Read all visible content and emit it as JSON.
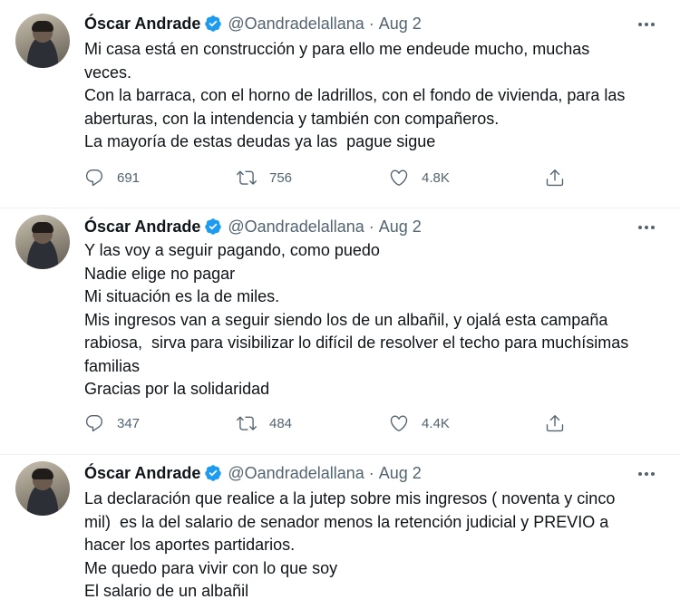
{
  "tweets": [
    {
      "author": "Óscar Andrade",
      "handle": "@Oandradelallana",
      "separator": "·",
      "date": "Aug 2",
      "lines": [
        "Mi casa está en construcción y para ello me endeude mucho, muchas",
        "veces.",
        "Con la barraca, con el horno de ladrillos, con el fondo de vivienda, para las",
        "aberturas, con la intendencia y también con compañeros.",
        "La mayoría de estas deudas ya las  pague sigue"
      ],
      "replies": "691",
      "retweets": "756",
      "likes": "4.8K"
    },
    {
      "author": "Óscar Andrade",
      "handle": "@Oandradelallana",
      "separator": "·",
      "date": "Aug 2",
      "lines": [
        "Y las voy a seguir pagando, como puedo",
        "Nadie elige no pagar",
        "Mi situación es la de miles.",
        "Mis ingresos van a seguir siendo los de un albañil, y ojalá esta campaña",
        "rabiosa,  sirva para visibilizar lo difícil de resolver el techo para muchísimas",
        "familias",
        "Gracias por la solidaridad"
      ],
      "replies": "347",
      "retweets": "484",
      "likes": "4.4K"
    },
    {
      "author": "Óscar Andrade",
      "handle": "@Oandradelallana",
      "separator": "·",
      "date": "Aug 2",
      "lines": [
        "La declaración que realice a la jutep sobre mis ingresos ( noventa y cinco",
        "mil)  es la del salario de senador menos la retención judicial y PREVIO a",
        "hacer los aportes partidarios.",
        "Me quedo para vivir con lo que soy",
        "El salario de un albañil"
      ]
    }
  ],
  "colors": {
    "text": "#0f1419",
    "secondary": "#536471",
    "verified": "#1d9bf0",
    "divider": "#eff3f4"
  },
  "icons": {
    "reply": "reply-icon",
    "retweet": "retweet-icon",
    "like": "heart-icon",
    "share": "share-icon",
    "verified": "verified-badge-icon",
    "more": "more-dots-icon"
  }
}
